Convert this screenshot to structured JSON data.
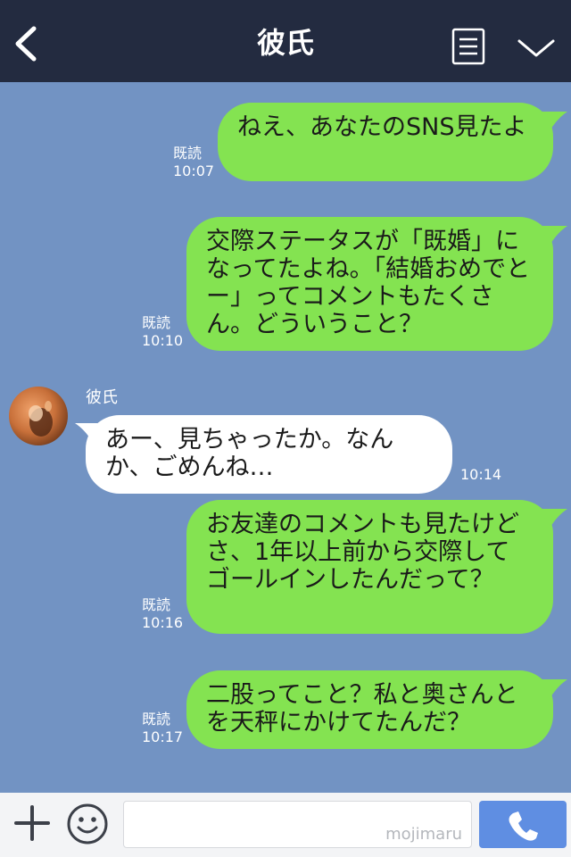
{
  "header": {
    "title": "彼氏"
  },
  "icons": {
    "back": "chevron-left-icon",
    "menu": "memo-icon",
    "collapse": "chevron-down-icon",
    "add": "plus-icon",
    "emoji": "smiley-icon",
    "call": "phone-icon"
  },
  "colors": {
    "header_bg": "#232b40",
    "chat_bg": "#7293c3",
    "my_bubble": "#84e351",
    "their_bubble": "#ffffff",
    "call_button": "#5f8ee2"
  },
  "messages": [
    {
      "sender": "me",
      "text": "ねえ、あなたのSNS見たよ",
      "read": "既読",
      "time": "10:07"
    },
    {
      "sender": "me",
      "text": "交際ステータスが「既婚」になってたよね。「結婚おめでとー」ってコメントもたくさん。どういうこと？",
      "read": "既読",
      "time": "10:10"
    },
    {
      "sender": "them",
      "name": "彼氏",
      "text": "あー、見ちゃったか。なんか、ごめんね…",
      "time": "10:14"
    },
    {
      "sender": "me",
      "text": "お友達のコメントも見たけどさ、1年以上前から交際してゴールインしたんだって？",
      "read": "既読",
      "time": "10:16"
    },
    {
      "sender": "me",
      "text": "二股ってこと？私と奥さんとを天秤にかけてたんだ？",
      "read": "既読",
      "time": "10:17"
    }
  ],
  "footer": {
    "watermark": "mojimaru"
  }
}
